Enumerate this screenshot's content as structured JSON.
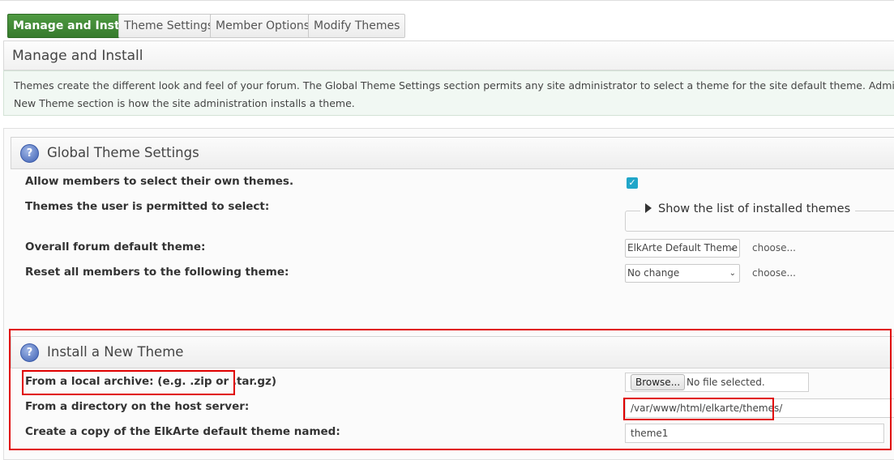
{
  "tabs": [
    {
      "label": "Manage and Install",
      "active": true
    },
    {
      "label": "Theme Settings",
      "active": false
    },
    {
      "label": "Member Options",
      "active": false
    },
    {
      "label": "Modify Themes",
      "active": false
    }
  ],
  "page_title": "Manage and Install",
  "info": {
    "line1": "Themes create the different look and feel of your forum. The Global Theme Settings section permits any site administrator to select a theme for the site default theme. Admins can also enable",
    "line2": "New Theme section is how the site administration installs a theme."
  },
  "global": {
    "title": "Global Theme Settings",
    "allow_label": "Allow members to select their own themes.",
    "allow_checked": true,
    "permitted_label": "Themes the user is permitted to select:",
    "show_list": "Show the list of installed themes",
    "default_label": "Overall forum default theme:",
    "default_value": "ElkArte Default Theme",
    "reset_label": "Reset all members to the following theme:",
    "reset_value": "No change",
    "choose": "choose..."
  },
  "install": {
    "title": "Install a New Theme",
    "archive_label": "From a local archive: (e.g. .zip or .tar.gz)",
    "browse": "Browse...",
    "no_file": "No file selected.",
    "directory_label": "From a directory on the host server:",
    "directory_value": "/var/www/html/elkarte/themes/",
    "copy_label": "Create a copy of the ElkArte default theme named:",
    "copy_value": "theme1"
  },
  "colors": {
    "accent": "#367a2c",
    "highlight": "#e00000",
    "checkbox": "#20a6c9"
  }
}
